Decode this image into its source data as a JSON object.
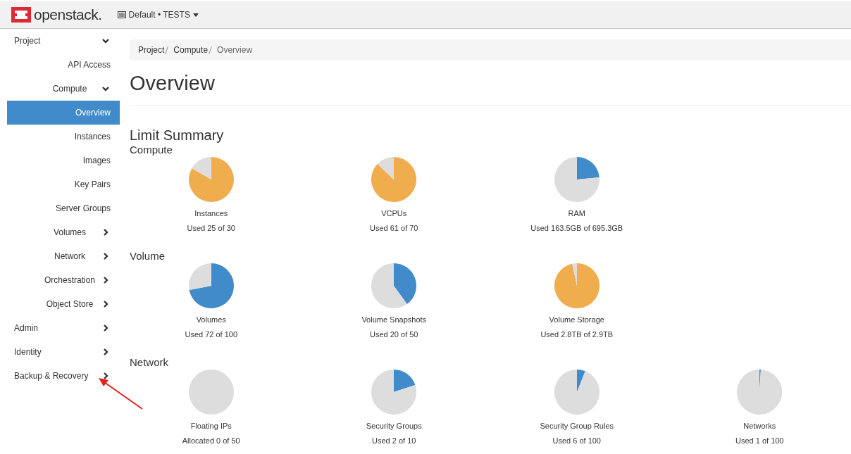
{
  "header": {
    "brand": "openstack.",
    "project_selector": "Default • TESTS"
  },
  "sidebar": {
    "items": [
      {
        "label": "Project",
        "kind": "section",
        "expanded": true,
        "selected": false
      },
      {
        "label": "API Access",
        "kind": "link",
        "selected": false
      },
      {
        "label": "Compute",
        "kind": "group",
        "expanded": true,
        "selected": false
      },
      {
        "label": "Overview",
        "kind": "link",
        "selected": true
      },
      {
        "label": "Instances",
        "kind": "link",
        "selected": false
      },
      {
        "label": "Images",
        "kind": "link",
        "selected": false
      },
      {
        "label": "Key Pairs",
        "kind": "link",
        "selected": false
      },
      {
        "label": "Server Groups",
        "kind": "link",
        "selected": false
      },
      {
        "label": "Volumes",
        "kind": "group",
        "expanded": false,
        "selected": false
      },
      {
        "label": "Network",
        "kind": "group",
        "expanded": false,
        "selected": false
      },
      {
        "label": "Orchestration",
        "kind": "group",
        "expanded": false,
        "selected": false
      },
      {
        "label": "Object Store",
        "kind": "group",
        "expanded": false,
        "selected": false
      },
      {
        "label": "Admin",
        "kind": "section",
        "expanded": false,
        "selected": false
      },
      {
        "label": "Identity",
        "kind": "section",
        "expanded": false,
        "selected": false
      },
      {
        "label": "Backup & Recovery",
        "kind": "section",
        "expanded": false,
        "selected": false
      }
    ]
  },
  "breadcrumb": [
    "Project",
    "Compute",
    "Overview"
  ],
  "title": "Overview",
  "limit_summary": {
    "title": "Limit Summary",
    "sections": [
      {
        "title": "Compute",
        "charts": [
          {
            "label": "Instances",
            "usage": "Used 25 of 30",
            "color": "#f0ad4e",
            "chart_data": {
              "type": "pie",
              "values": [
                83.3,
                16.7
              ]
            }
          },
          {
            "label": "VCPUs",
            "usage": "Used 61 of 70",
            "color": "#f0ad4e",
            "chart_data": {
              "type": "pie",
              "values": [
                87.1,
                12.9
              ]
            }
          },
          {
            "label": "RAM",
            "usage": "Used 163.5GB of 695.3GB",
            "color": "#428bca",
            "chart_data": {
              "type": "pie",
              "values": [
                23.5,
                76.5
              ]
            }
          }
        ]
      },
      {
        "title": "Volume",
        "charts": [
          {
            "label": "Volumes",
            "usage": "Used 72 of 100",
            "color": "#428bca",
            "chart_data": {
              "type": "pie",
              "values": [
                72,
                28
              ]
            }
          },
          {
            "label": "Volume Snapshots",
            "usage": "Used 20 of 50",
            "color": "#428bca",
            "chart_data": {
              "type": "pie",
              "values": [
                40,
                60
              ]
            }
          },
          {
            "label": "Volume Storage",
            "usage": "Used 2.8TB of 2.9TB",
            "color": "#f0ad4e",
            "chart_data": {
              "type": "pie",
              "values": [
                96.6,
                3.4
              ]
            }
          }
        ]
      },
      {
        "title": "Network",
        "charts": [
          {
            "label": "Floating IPs",
            "usage": "Allocated 0 of 50",
            "chart_data": {
              "type": "pie",
              "values": [
                0,
                100
              ]
            }
          },
          {
            "label": "Security Groups",
            "usage": "Used 2 of 10",
            "color": "#428bca",
            "chart_data": {
              "type": "pie",
              "values": [
                20,
                80
              ]
            }
          },
          {
            "label": "Security Group Rules",
            "usage": "Used 6 of 100",
            "color": "#428bca",
            "chart_data": {
              "type": "pie",
              "values": [
                6,
                94
              ]
            }
          },
          {
            "label": "Networks",
            "usage": "Used 1 of 100",
            "color": "#428bca",
            "chart_data": {
              "type": "pie",
              "values": [
                1,
                99
              ]
            }
          }
        ]
      }
    ]
  }
}
